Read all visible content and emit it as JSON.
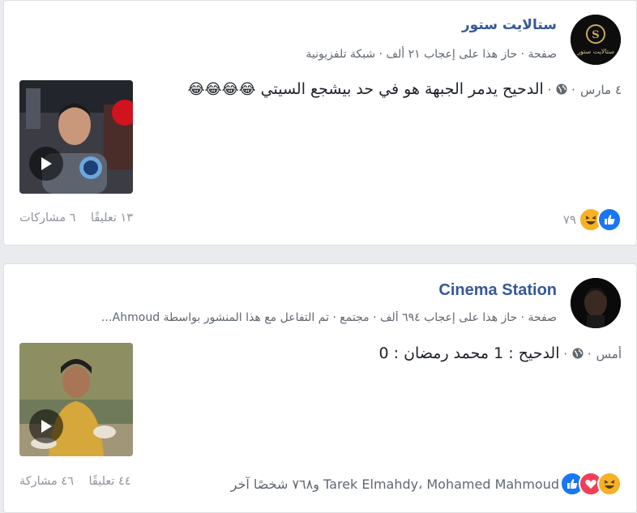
{
  "posts": [
    {
      "page_name": "ستالايت ستور",
      "avatar_text": "ستالايت ستور",
      "meta": "صفحة · حاز هذا على إعجاب ٢١ ألف · شبكة تلفزيونية",
      "date": "٤ مارس",
      "text": "الدحيح يدمر الجبهة هو في حد بيشجع السيتي",
      "emoji": "😂😂😂😂",
      "reaction_count": "٧٩",
      "comments": "١٣ تعليقًا",
      "shares": "٦ مشاركات",
      "reaction_icons": [
        "like-icon",
        "haha-icon"
      ]
    },
    {
      "page_name": "Cinema Station",
      "meta": "صفحة · حاز هذا على إعجاب ٦٩٤ ألف · مجتمع · تم التفاعل مع هذا المنشور بواسطة Ahmoud…",
      "date": "أمس",
      "text": "الدحيح : 1 محمد رمضان : 0",
      "reactors": "Tarek Elmahdy، Mohamed Mahmoud و٧٦٨ شخصًا آخر",
      "comments": "٤٤ تعليقًا",
      "shares": "٤٦ مشاركة",
      "reaction_icons": [
        "like-icon",
        "love-icon",
        "haha-icon"
      ]
    }
  ],
  "colors": {
    "link": "#365899",
    "meta": "#606770",
    "muted": "#90949c",
    "like": "#1877f2",
    "love": "#f33e58",
    "haha": "#f7b125"
  }
}
